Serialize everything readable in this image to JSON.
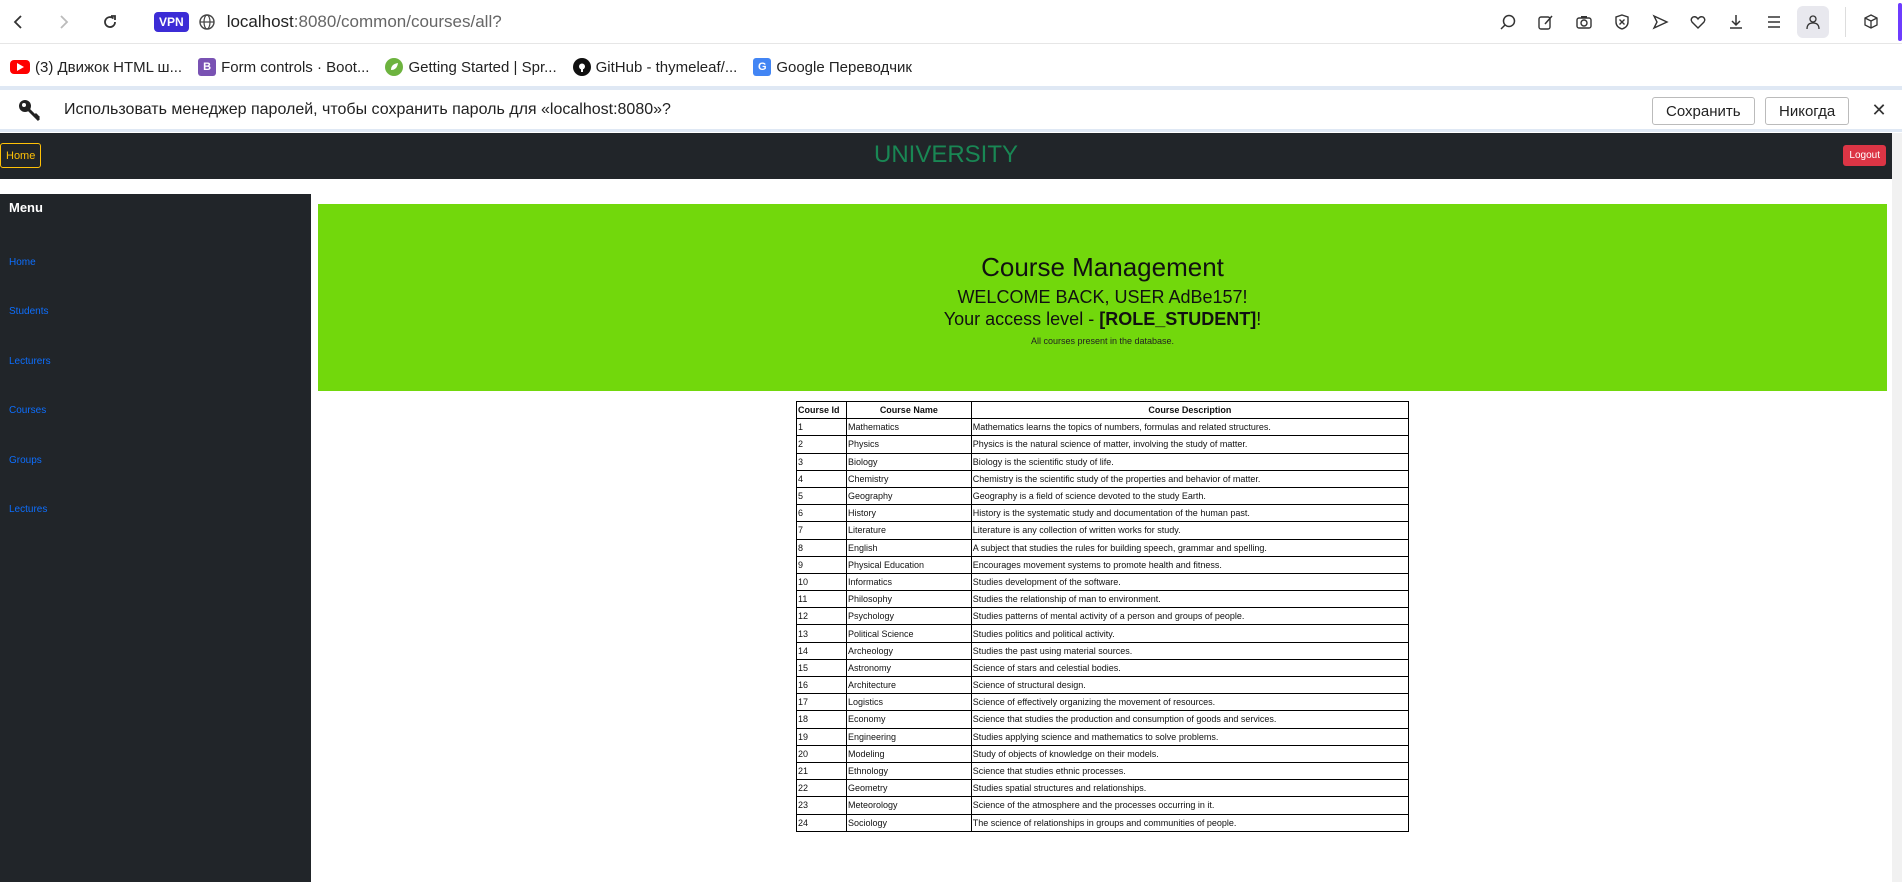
{
  "browser": {
    "vpn_label": "VPN",
    "url_host": "localhost",
    "url_rest": ":8080/common/courses/all?"
  },
  "bookmarks": [
    {
      "label": "(3) Движок HTML ш...",
      "icon": "youtube-icon",
      "color": "#ff0000"
    },
    {
      "label": "Form controls · Boot...",
      "icon": "bootstrap-icon",
      "color": "#7952b3"
    },
    {
      "label": "Getting Started | Spr...",
      "icon": "spring-icon",
      "color": "#6db33f"
    },
    {
      "label": "GitHub - thymeleaf/...",
      "icon": "github-icon",
      "color": "#111111"
    },
    {
      "label": "Google Переводчик",
      "icon": "google-translate-icon",
      "color": "#4285f4"
    }
  ],
  "password_bar": {
    "message": "Использовать менеджер паролей, чтобы сохранить пароль для «localhost:8080»?",
    "save_label": "Сохранить",
    "never_label": "Никогда"
  },
  "topnav": {
    "home_label": "Home",
    "brand": "UNIVERSITY",
    "logout_label": "Logout"
  },
  "sidebar": {
    "title": "Menu",
    "items": [
      "Home",
      "Students",
      "Lecturers",
      "Courses",
      "Groups",
      "Lectures"
    ]
  },
  "banner": {
    "title": "Course Management",
    "welcome": "WELCOME BACK, USER AdBe157!",
    "access_prefix": "Your access level - ",
    "access_role": "[ROLE_STUDENT]",
    "access_suffix": "!",
    "subtitle": "All courses present in the database."
  },
  "table": {
    "headers": [
      "Course Id",
      "Course Name",
      "Course Description"
    ],
    "rows": [
      [
        "1",
        "Mathematics",
        "Mathematics learns the topics of numbers, formulas and related structures."
      ],
      [
        "2",
        "Physics",
        "Physics is the natural science of matter, involving the study of matter."
      ],
      [
        "3",
        "Biology",
        "Biology is the scientific study of life."
      ],
      [
        "4",
        "Chemistry",
        "Chemistry is the scientific study of the properties and behavior of matter."
      ],
      [
        "5",
        "Geography",
        "Geography is a field of science devoted to the study Earth."
      ],
      [
        "6",
        "History",
        "History is the systematic study and documentation of the human past."
      ],
      [
        "7",
        "Literature",
        "Literature is any collection of written works for study."
      ],
      [
        "8",
        "English",
        "A subject that studies the rules for building speech, grammar and spelling."
      ],
      [
        "9",
        "Physical Education",
        "Encourages movement systems to promote health and fitness."
      ],
      [
        "10",
        "Informatics",
        "Studies development of the software."
      ],
      [
        "11",
        "Philosophy",
        "Studies the relationship of man to environment."
      ],
      [
        "12",
        "Psychology",
        "Studies patterns of mental activity of a person and groups of people."
      ],
      [
        "13",
        "Political Science",
        "Studies politics and political activity."
      ],
      [
        "14",
        "Archeology",
        "Studies the past using material sources."
      ],
      [
        "15",
        "Astronomy",
        "Science of stars and celestial bodies."
      ],
      [
        "16",
        "Architecture",
        "Science of structural design."
      ],
      [
        "17",
        "Logistics",
        "Science of effectively organizing the movement of resources."
      ],
      [
        "18",
        "Economy",
        "Science that studies the production and consumption of goods and services."
      ],
      [
        "19",
        "Engineering",
        "Studies applying science and mathematics to solve problems."
      ],
      [
        "20",
        "Modeling",
        "Study of objects of knowledge on their models."
      ],
      [
        "21",
        "Ethnology",
        "Science that studies ethnic processes."
      ],
      [
        "22",
        "Geometry",
        "Studies spatial structures and relationships."
      ],
      [
        "23",
        "Meteorology",
        "Science of the atmosphere and the processes occurring in it."
      ],
      [
        "24",
        "Sociology",
        "The science of relationships in groups and communities of people."
      ]
    ]
  },
  "colors": {
    "navbar": "#212529",
    "banner": "#72d80c",
    "brand": "#198754",
    "link": "#0d6efd",
    "logout": "#dc3545",
    "home_outline": "#ffc107",
    "vpn": "#3c2cd6"
  }
}
